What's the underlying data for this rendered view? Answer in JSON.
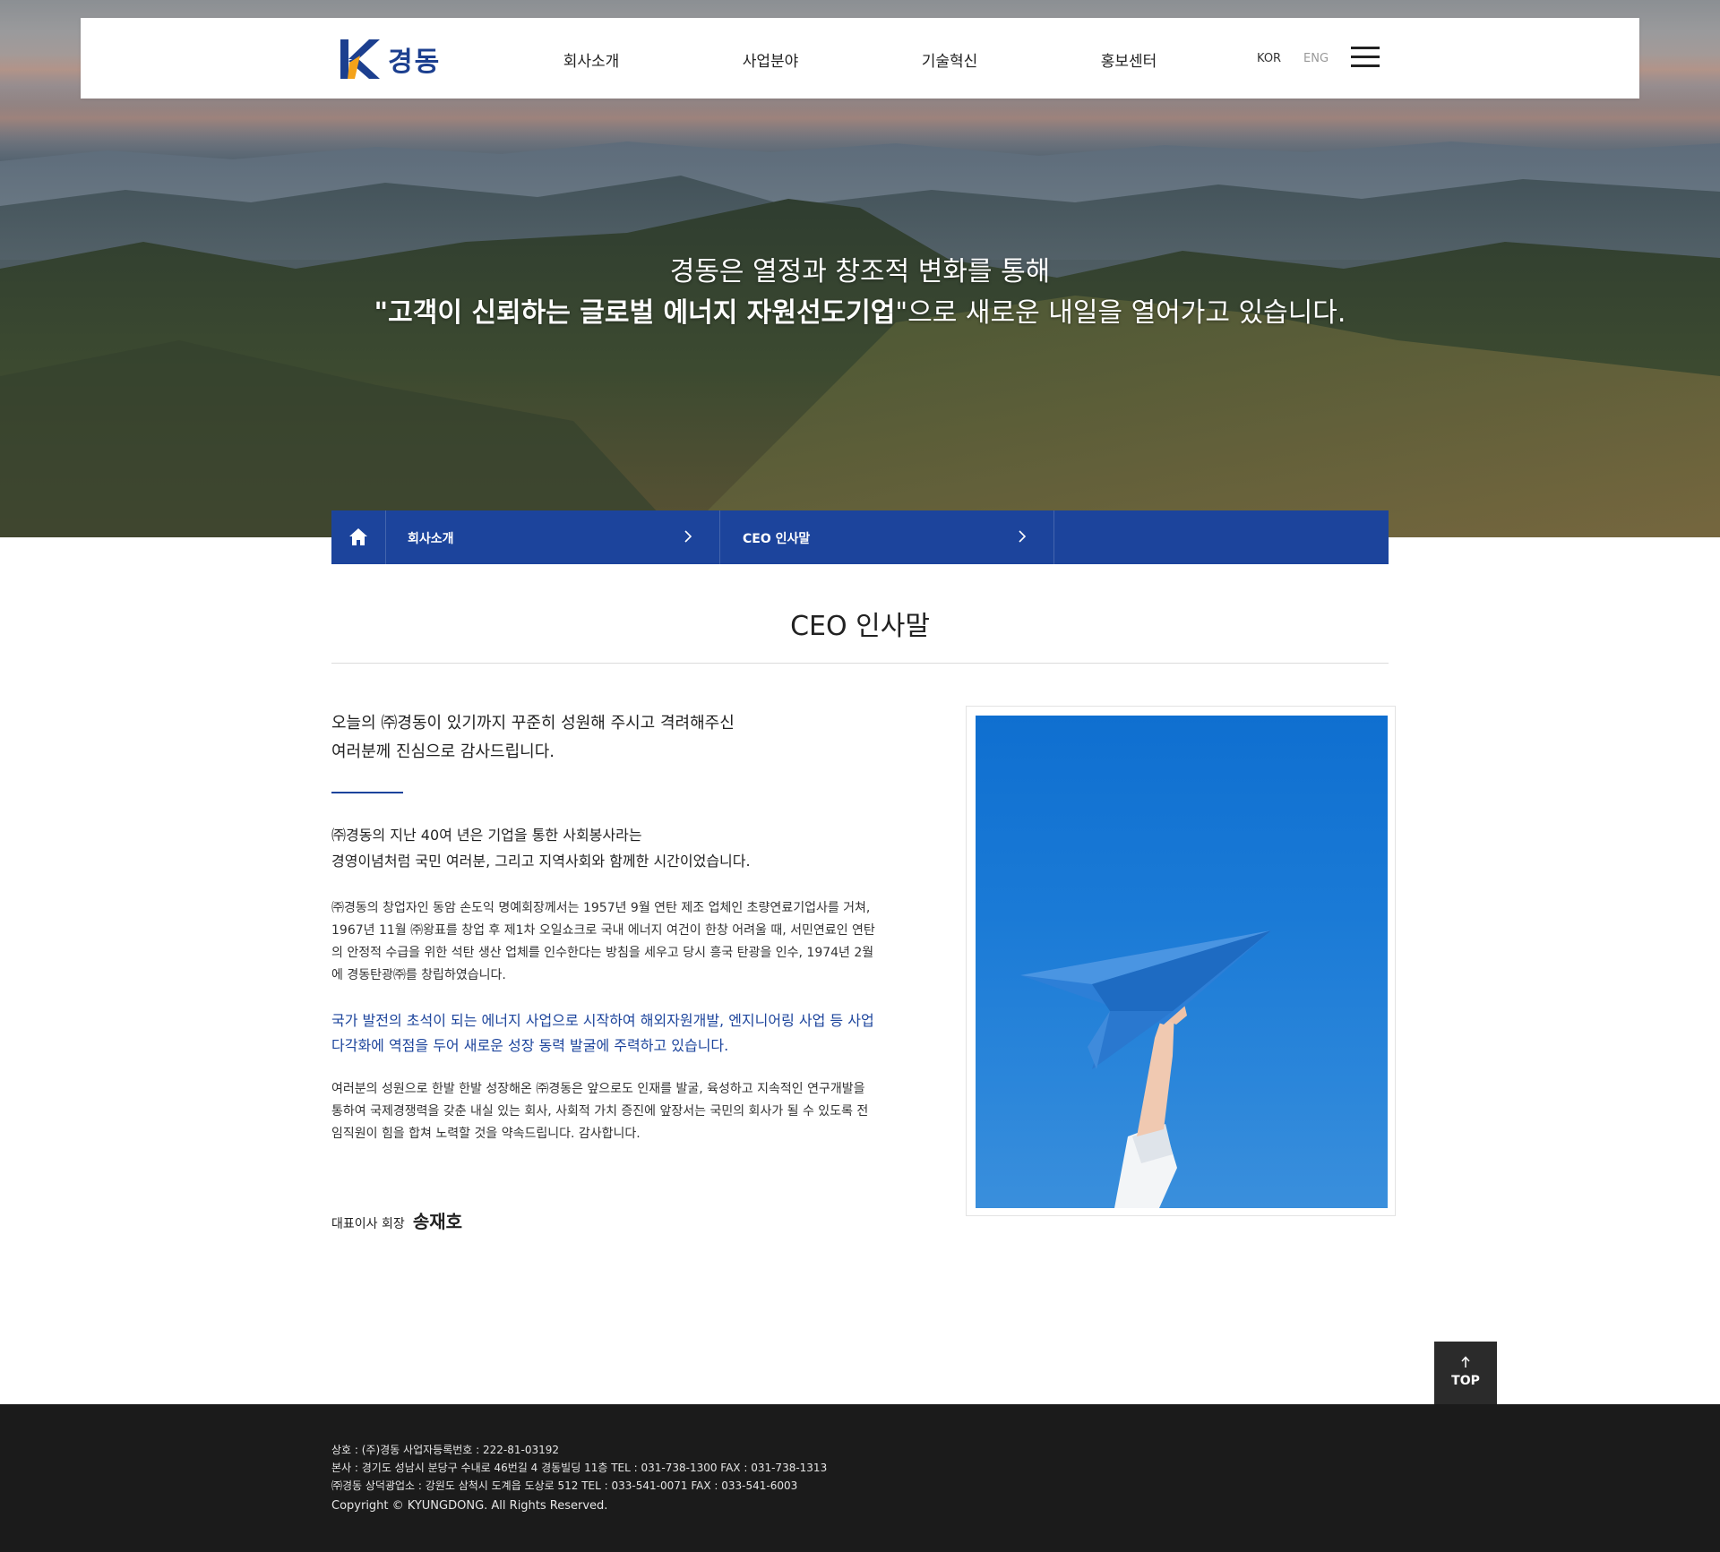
{
  "header": {
    "logo_text": "경동",
    "nav": [
      "회사소개",
      "사업분야",
      "기술혁신",
      "홍보센터"
    ],
    "lang_kor": "KOR",
    "lang_eng": "ENG"
  },
  "hero": {
    "line1": "경동은 열정과 창조적 변화를 통해",
    "line2_bold": "\"고객이 신뢰하는 글로벌 에너지 자원선도기업",
    "line2_rest": "\"으로 새로운 내일을 열어가고 있습니다."
  },
  "breadcrumb": {
    "home_icon": "home-icon",
    "items": [
      "회사소개",
      "CEO 인사말"
    ]
  },
  "page": {
    "title": "CEO 인사말"
  },
  "content": {
    "lead_line1": "오늘의 ㈜경동이 있기까지 꾸준히 성원해 주시고 격려해주신",
    "lead_line2": "여러분께 진심으로 감사드립니다.",
    "para1_line1": "㈜경동의 지난 40여 년은 기업을 통한 사회봉사라는",
    "para1_line2": "경영이념처럼 국민 여러분, 그리고 지역사회와 함께한 시간이었습니다.",
    "para2_line1": "㈜경동의 창업자인 동암 손도익 명예회장께서는 1957년 9월 연탄 제조 업체인 초량연료기업사를 거쳐,",
    "para2_line2": "1967년 11월 ㈜왕표를 창업 후 제1차 오일쇼크로 국내 에너지 여건이 한창 어려울 때, 서민연료인 연탄",
    "para2_line3": "의 안정적 수급을 위한 석탄 생산 업체를 인수한다는 방침을 세우고 당시 흥국 탄광을 인수, 1974년 2월",
    "para2_line4": "에 경동탄광㈜를 창립하였습니다.",
    "para3_line1": "국가 발전의 초석이 되는 에너지 사업으로 시작하여 해외자원개발, 엔지니어링 사업 등 사업",
    "para3_line2": "다각화에 역점을 두어 새로운 성장 동력 발굴에 주력하고 있습니다.",
    "para4_line1": "여러분의 성원으로 한발 한발 성장해온 ㈜경동은 앞으로도 인재를 발굴, 육성하고 지속적인 연구개발을",
    "para4_line2": "통하여 국제경쟁력을 갖춘 내실 있는 회사, 사회적 가치 증진에 앞장서는 국민의 회사가 될 수 있도록 전",
    "para4_line3": "임직원이 힘을 합쳐 노력할 것을 약속드립니다. 감사합니다.",
    "signature_role": "대표이사 회장",
    "signature_name": "송재호"
  },
  "top_button": {
    "label": "TOP"
  },
  "footer": {
    "line1": "상호 : (주)경동 사업자등록번호 : 222-81-03192",
    "line2": "본사 : 경기도 성남시 분당구 수내로 46번길 4 경동빌딩 11층 TEL : 031-738-1300 FAX : 031-738-1313",
    "line3": "㈜경동 상덕광업소 : 강원도 삼척시 도계읍 도상로 512 TEL : 033-541-0071 FAX : 033-541-6003",
    "copyright": "Copyright © KYUNGDONG. All Rights Reserved."
  },
  "colors": {
    "brand_blue": "#1c449c",
    "footer_bg": "#1b1b1b"
  }
}
